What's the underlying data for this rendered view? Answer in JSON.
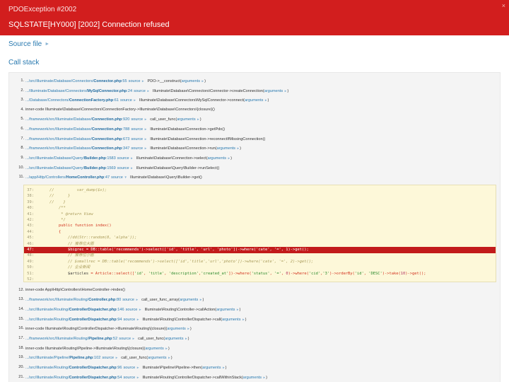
{
  "header": {
    "exception_class": "PDOException #2002",
    "message": "SQLSTATE[HY000] [2002] Connection refused",
    "close_glyph": "×"
  },
  "sections": {
    "source_file": "Source file",
    "call_stack": "Call stack",
    "arrow": "►"
  },
  "trace_labels": {
    "source": "source",
    "arguments": "arguments",
    "arrow_closed": "►",
    "arrow_open": "▼"
  },
  "trace": [
    {
      "num": "1.",
      "file_prefix": ".../src/Illuminate/Database/Connectors/",
      "file_name": "Connector.php",
      "line": ":55",
      "has_source": true,
      "call": "PDO->__construct(",
      "has_args": true,
      "call_end": ")"
    },
    {
      "num": "2.",
      "file_prefix": ".../Illuminate/Database/Connectors/",
      "file_name": "MySqlConnector.php",
      "line": ":24",
      "has_source": true,
      "call": "Illuminate\\Database\\Connectors\\Connector->createConnection(",
      "has_args": true,
      "call_end": ")"
    },
    {
      "num": "3.",
      "file_prefix": ".../Database/Connectors/",
      "file_name": "ConnectionFactory.php",
      "line": ":61",
      "has_source": true,
      "call": "Illuminate\\Database\\Connectors\\MySqlConnector->connect(",
      "has_args": true,
      "call_end": ")"
    },
    {
      "num": "4.",
      "file_prefix": "",
      "file_name": "",
      "line": "",
      "has_source": false,
      "call": "inner-code Illuminate\\Database\\Connectors\\ConnectionFactory->Illuminate\\Database\\Connectors\\{closure}(",
      "has_args": false,
      "call_end": ")"
    },
    {
      "num": "5.",
      "file_prefix": ".../framework/src/Illuminate/Database/",
      "file_name": "Connection.php",
      "line": ":920",
      "has_source": true,
      "call": "call_user_func(",
      "has_args": true,
      "call_end": ")"
    },
    {
      "num": "6.",
      "file_prefix": ".../framework/src/Illuminate/Database/",
      "file_name": "Connection.php",
      "line": ":788",
      "has_source": true,
      "call": "Illuminate\\Database\\Connection->getPdo()",
      "has_args": false,
      "call_end": ""
    },
    {
      "num": "7.",
      "file_prefix": ".../framework/src/Illuminate/Database/",
      "file_name": "Connection.php",
      "line": ":673",
      "has_source": true,
      "call": "Illuminate\\Database\\Connection->reconnectIfMissingConnection()",
      "has_args": false,
      "call_end": ""
    },
    {
      "num": "8.",
      "file_prefix": ".../framework/src/Illuminate/Database/",
      "file_name": "Connection.php",
      "line": ":347",
      "has_source": true,
      "call": "Illuminate\\Database\\Connection->run(",
      "has_args": true,
      "call_end": ")"
    },
    {
      "num": "9.",
      "file_prefix": ".../src/Illuminate/Database/Query/",
      "file_name": "Builder.php",
      "line": ":1583",
      "has_source": true,
      "call": "Illuminate\\Database\\Connection->select(",
      "has_args": true,
      "call_end": ")"
    },
    {
      "num": "10.",
      "file_prefix": ".../src/Illuminate/Database/Query/",
      "file_name": "Builder.php",
      "line": ":1569",
      "has_source": true,
      "call": "Illuminate\\Database\\Query\\Builder->runSelect()",
      "has_args": false,
      "call_end": ""
    },
    {
      "num": "11.",
      "file_prefix": ".../app/Http/Controllers/",
      "file_name": "HomeController.php",
      "line": ":47",
      "has_source": true,
      "open": true,
      "call": "Illuminate\\Database\\Query\\Builder->get()",
      "has_args": false,
      "call_end": ""
    },
    {
      "num": "12.",
      "file_prefix": "",
      "file_name": "",
      "line": "",
      "has_source": false,
      "call": "inner-code App\\Http\\Controllers\\HomeController->index()",
      "has_args": false,
      "call_end": ""
    },
    {
      "num": "13.",
      "file_prefix": ".../framework/src/Illuminate/Routing/",
      "file_name": "Controller.php",
      "line": ":80",
      "has_source": true,
      "call": "call_user_func_array(",
      "has_args": true,
      "call_end": ")"
    },
    {
      "num": "14.",
      "file_prefix": ".../src/Illuminate/Routing/",
      "file_name": "ControllerDispatcher.php",
      "line": ":146",
      "has_source": true,
      "call": "Illuminate\\Routing\\Controller->callAction(",
      "has_args": true,
      "call_end": ")"
    },
    {
      "num": "15.",
      "file_prefix": ".../src/Illuminate/Routing/",
      "file_name": "ControllerDispatcher.php",
      "line": ":94",
      "has_source": true,
      "call": "Illuminate\\Routing\\ControllerDispatcher->call(",
      "has_args": true,
      "call_end": ")"
    },
    {
      "num": "16.",
      "file_prefix": "",
      "file_name": "",
      "line": "",
      "has_source": false,
      "call": "inner-code Illuminate\\Routing\\ControllerDispatcher->Illuminate\\Routing\\{closure}(",
      "has_args": true,
      "call_end": ")"
    },
    {
      "num": "17.",
      "file_prefix": ".../framework/src/Illuminate/Routing/",
      "file_name": "Pipeline.php",
      "line": ":52",
      "has_source": true,
      "call": "call_user_func(",
      "has_args": true,
      "call_end": ")"
    },
    {
      "num": "18.",
      "file_prefix": "",
      "file_name": "",
      "line": "",
      "has_source": false,
      "call": "inner-code Illuminate\\Routing\\Pipeline->Illuminate\\Routing\\{closure}(",
      "has_args": true,
      "call_end": ")"
    },
    {
      "num": "19.",
      "file_prefix": ".../src/Illuminate/Pipeline/",
      "file_name": "Pipeline.php",
      "line": ":102",
      "has_source": true,
      "call": "call_user_func(",
      "has_args": true,
      "call_end": ")"
    },
    {
      "num": "20.",
      "file_prefix": ".../src/Illuminate/Routing/",
      "file_name": "ControllerDispatcher.php",
      "line": ":96",
      "has_source": true,
      "call": "Illuminate\\Pipeline\\Pipeline->then(",
      "has_args": true,
      "call_end": ")"
    },
    {
      "num": "21.",
      "file_prefix": ".../src/Illuminate/Routing/",
      "file_name": "ControllerDispatcher.php",
      "line": ":54",
      "has_source": true,
      "call": "Illuminate\\Routing\\ControllerDispatcher->callWithinStack(",
      "has_args": true,
      "call_end": ")"
    }
  ],
  "code": [
    {
      "ln": "37:",
      "text": "    //          var_dump($v);",
      "kind": "comment"
    },
    {
      "ln": "38:",
      "text": "    //      }",
      "kind": "comment"
    },
    {
      "ln": "39:",
      "text": "    //    }",
      "kind": "comment"
    },
    {
      "ln": "40:",
      "text": "        /**",
      "kind": "comment"
    },
    {
      "ln": "41:",
      "text": "         * @return View",
      "kind": "comment"
    },
    {
      "ln": "42:",
      "text": "         */",
      "kind": "comment"
    },
    {
      "ln": "43:",
      "text": "        public function index()",
      "kind": "code"
    },
    {
      "ln": "44:",
      "text": "        {",
      "kind": "code"
    },
    {
      "ln": "45:",
      "text": "            //dd(Str::random(8, 'alpha'));",
      "kind": "comment"
    },
    {
      "ln": "46:",
      "text": "            // 推荐位大图",
      "kind": "comment"
    },
    {
      "ln": "47:",
      "text": "            $bigrec = DB::table('recommends')->select(['id', 'title', 'url', 'photo'])->where('cate', '=', 1)->get();",
      "kind": "error"
    },
    {
      "ln": "48:",
      "text": "            // 推荐位小图",
      "kind": "comment"
    },
    {
      "ln": "49:",
      "text": "            // $smallrec = DB::table('recommends')->select(['id','title','url','photo'])->where('cate', '=', 2)->get();",
      "kind": "comment"
    },
    {
      "ln": "50:",
      "text": "            // 企业新闻",
      "kind": "comment"
    },
    {
      "ln": "51:",
      "text": "            $articles = Article::select(['id', 'title', 'description','created_at'])->where('status', '=', 0)->where('cid','3')->orderBy('id', 'DESC')->take(10)->get();",
      "kind": "code"
    },
    {
      "ln": "52:",
      "text": "",
      "kind": "code"
    }
  ]
}
